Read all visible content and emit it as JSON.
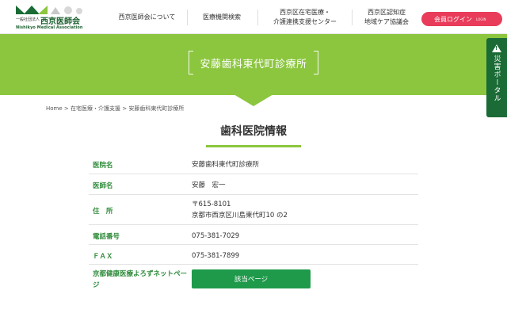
{
  "header": {
    "logo": {
      "small_text": "一般社団法人",
      "name": "西京医師会",
      "english": "Nishikyo Medical Association"
    },
    "nav": [
      {
        "lines": [
          "西京医師会について"
        ]
      },
      {
        "lines": [
          "医療機関検索"
        ]
      },
      {
        "lines": [
          "西京区在宅医療・",
          "介護連携支援センター"
        ]
      },
      {
        "lines": [
          "西京区認知症",
          "地域ケア協議会"
        ]
      }
    ],
    "login": {
      "label": "会員ログイン",
      "sub": "LOGIN"
    }
  },
  "banner": {
    "title": "安藤歯科東代町診療所"
  },
  "side_tab": {
    "label": "災害ポータル"
  },
  "breadcrumb": {
    "home": "Home",
    "sep1": " > ",
    "parent": "在宅医療・介護支援",
    "sep2": " > ",
    "current": "安藤歯科東代町診療所"
  },
  "section": {
    "title": "歯科医院情報"
  },
  "info": {
    "clinic_label": "医院名",
    "clinic_value": "安藤歯科東代町診療所",
    "doctor_label": "医師名",
    "doctor_value": "安藤　宏一",
    "address_label": "住　所",
    "address_zip": "〒615-8101",
    "address_line": "京都市西京区川島東代町10 の2",
    "phone_label": "電話番号",
    "phone_value": "075-381-7029",
    "fax_label": "ＦＡＸ",
    "fax_value": "075-381-7899",
    "kyoto_label": "京都健康医療よろずネットページ",
    "kyoto_button": "該当ページ"
  },
  "colors": {
    "brand_green": "#8cc63f",
    "dark_green": "#1a6b35",
    "label_green": "#2e8b3a",
    "button_green": "#1e9a4a",
    "login_pink": "#e83c5a"
  }
}
